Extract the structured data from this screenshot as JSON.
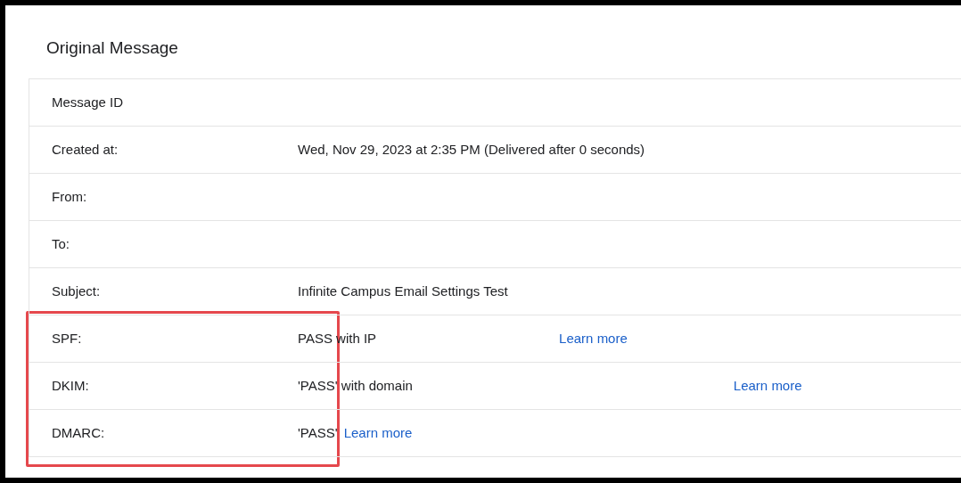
{
  "title": "Original Message",
  "rows": [
    {
      "label": "Message ID"
    },
    {
      "label": "Created at:",
      "value": "Wed, Nov 29, 2023 at 2:35 PM (Delivered after 0 seconds)"
    },
    {
      "label": "From:"
    },
    {
      "label": "To:"
    },
    {
      "label": "Subject:",
      "value": "Infinite Campus Email Settings Test"
    },
    {
      "label": "SPF:",
      "value": "PASS with IP",
      "link": "Learn more"
    },
    {
      "label": "DKIM:",
      "value": "'PASS' with domain",
      "link": "Learn more"
    },
    {
      "label": "DMARC:",
      "value": "'PASS'",
      "link": "Learn more"
    }
  ]
}
